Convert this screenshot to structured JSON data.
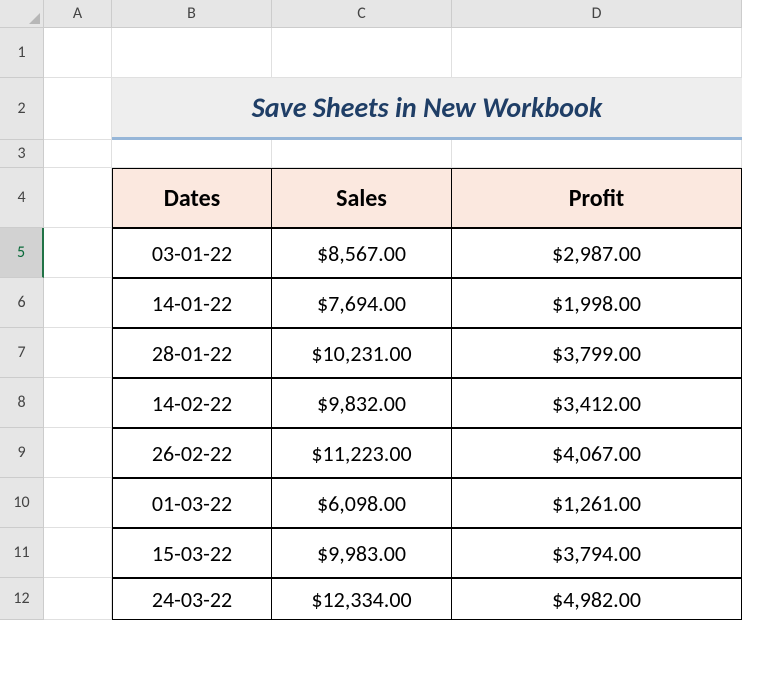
{
  "columns": {
    "A": "A",
    "B": "B",
    "C": "C",
    "D": "D"
  },
  "rows": [
    "1",
    "2",
    "3",
    "4",
    "5",
    "6",
    "7",
    "8",
    "9",
    "10",
    "11",
    "12"
  ],
  "title": "Save Sheets in New Workbook",
  "table": {
    "headers": {
      "dates": "Dates",
      "sales": "Sales",
      "profit": "Profit"
    },
    "data": [
      {
        "date": "03-01-22",
        "sales": "$8,567.00",
        "profit": "$2,987.00"
      },
      {
        "date": "14-01-22",
        "sales": "$7,694.00",
        "profit": "$1,998.00"
      },
      {
        "date": "28-01-22",
        "sales": "$10,231.00",
        "profit": "$3,799.00"
      },
      {
        "date": "14-02-22",
        "sales": "$9,832.00",
        "profit": "$3,412.00"
      },
      {
        "date": "26-02-22",
        "sales": "$11,223.00",
        "profit": "$4,067.00"
      },
      {
        "date": "01-03-22",
        "sales": "$6,098.00",
        "profit": "$1,261.00"
      },
      {
        "date": "15-03-22",
        "sales": "$9,983.00",
        "profit": "$3,794.00"
      },
      {
        "date": "24-03-22",
        "sales": "$12,334.00",
        "profit": "$4,982.00"
      }
    ]
  },
  "selected_row": "5"
}
